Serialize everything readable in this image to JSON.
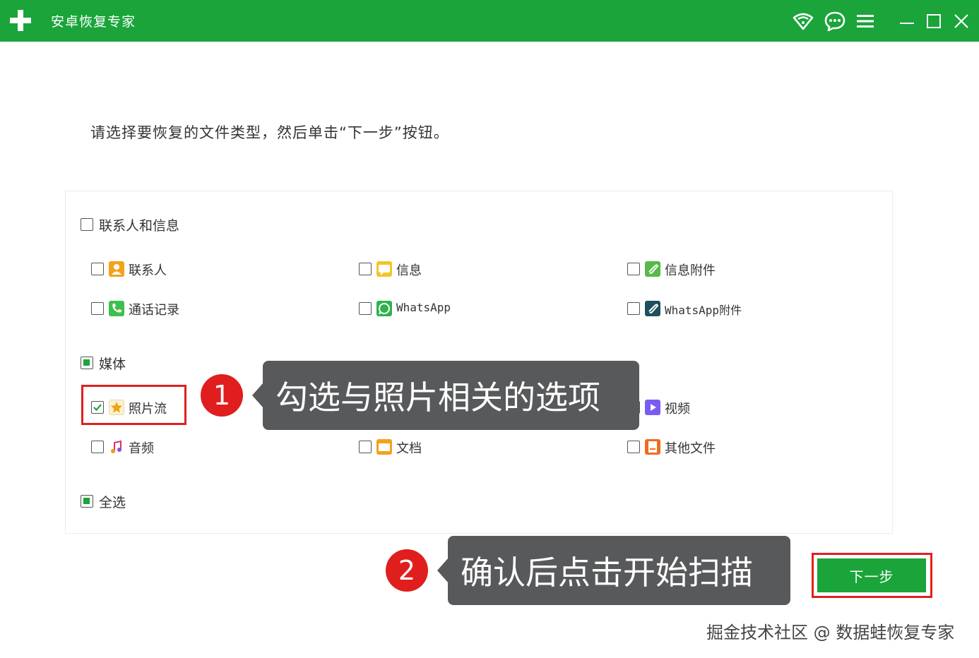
{
  "window": {
    "title": "安卓恢复专家",
    "colors": {
      "titlebar": "#1aa43a",
      "accent": "#1aa43a",
      "highlight": "#e02020",
      "callout": "#58595b"
    },
    "titlebar_icons": [
      "wifi-icon",
      "chat-icon",
      "menu-icon",
      "minimize-icon",
      "maximize-icon",
      "close-icon"
    ]
  },
  "instruction": "请选择要恢复的文件类型，然后单击“下一步”按钮。",
  "groups": {
    "contacts": {
      "label": "联系人和信息",
      "items": {
        "contacts": "联系人",
        "messages": "信息",
        "message_attachments": "信息附件",
        "call_logs": "通话记录",
        "whatsapp": "WhatsApp",
        "whatsapp_attachments": "WhatsApp附件"
      }
    },
    "media": {
      "label": "媒体",
      "items": {
        "photo_stream": "照片流",
        "video": "视频",
        "audio": "音频",
        "documents": "文档",
        "other_files": "其他文件"
      }
    },
    "select_all": "全选"
  },
  "callouts": {
    "step1": {
      "number": "1",
      "text": "勾选与照片相关的选项"
    },
    "step2": {
      "number": "2",
      "text": "确认后点击开始扫描"
    }
  },
  "next_button": "下一步",
  "watermark": "掘金技术社区 @ 数据蛙恢复专家"
}
